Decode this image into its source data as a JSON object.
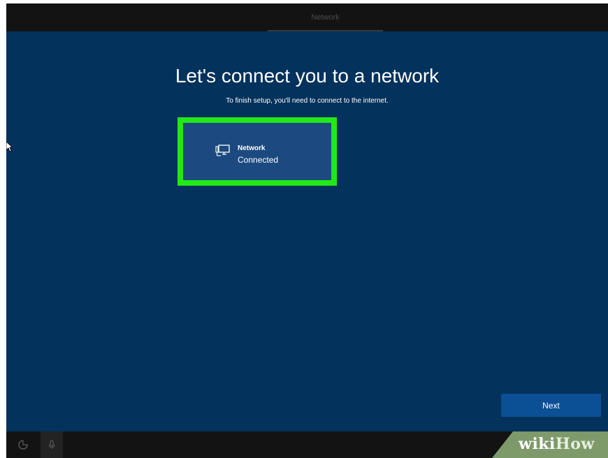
{
  "topbar": {
    "tab_label": "Network"
  },
  "main": {
    "heading": "Let's connect you to a network",
    "subheading": "To finish setup, you'll need to connect to the internet."
  },
  "network": {
    "name": "Network",
    "status": "Connected",
    "icon": "wired-network-icon"
  },
  "actions": {
    "next_label": "Next"
  },
  "bottombar": {
    "icons": [
      "ease-of-access-icon",
      "microphone-icon"
    ]
  },
  "watermark": {
    "part1": "wiki",
    "part2": "How"
  },
  "colors": {
    "background": "#03325c",
    "highlight": "#22e81a",
    "button": "#0b4f94",
    "bars": "#131313"
  }
}
